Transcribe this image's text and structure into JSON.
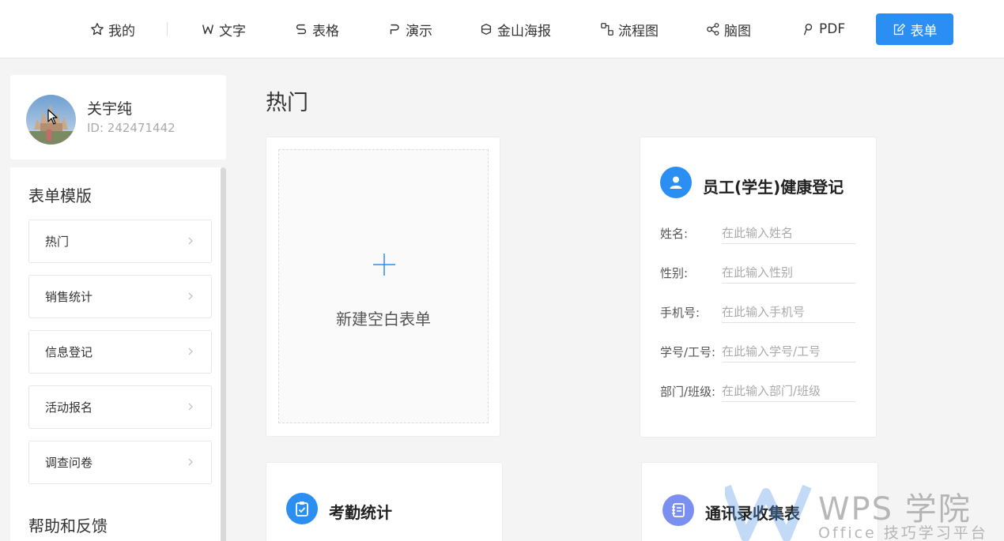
{
  "nav": {
    "mine": "我的",
    "doc": "文字",
    "sheet": "表格",
    "slides": "演示",
    "poster": "金山海报",
    "flow": "流程图",
    "mind": "脑图",
    "pdf": "PDF",
    "form": "表单"
  },
  "profile": {
    "name": "关宇纯",
    "id": "ID: 242471442"
  },
  "sidebar": {
    "templates_heading": "表单模版",
    "items": [
      {
        "label": "热门"
      },
      {
        "label": "销售统计"
      },
      {
        "label": "信息登记"
      },
      {
        "label": "活动报名"
      },
      {
        "label": "调查问卷"
      }
    ],
    "help_heading": "帮助和反馈"
  },
  "main": {
    "section_title": "热门",
    "new_form_label": "新建空白表单",
    "health_form": {
      "title": "员工(学生)健康登记",
      "fields": [
        {
          "label": "姓名:",
          "placeholder": "在此输入姓名"
        },
        {
          "label": "性别:",
          "placeholder": "在此输入性别"
        },
        {
          "label": "手机号:",
          "placeholder": "在此输入手机号"
        },
        {
          "label": "学号/工号:",
          "placeholder": "在此输入学号/工号"
        },
        {
          "label": "部门/班级:",
          "placeholder": "在此输入部门/班级"
        }
      ]
    },
    "attendance_form": {
      "title": "考勤统计"
    },
    "contacts_form": {
      "title": "通讯录收集表"
    }
  },
  "watermark": {
    "main": "WPS 学院",
    "sub": "Office 技巧学习平台"
  },
  "colors": {
    "accent": "#2a8ef2",
    "attendance_icon": "#2a8ef2",
    "contacts_icon": "#7b8ff0"
  },
  "icons": [
    "star-icon",
    "w-icon",
    "s-icon",
    "p-icon",
    "poster-icon",
    "flowchart-icon",
    "mindmap-icon",
    "pdf-icon",
    "form-edit-icon",
    "user-icon",
    "clipboard-check-icon",
    "notebook-icon",
    "plus-icon",
    "chevron-right-icon"
  ]
}
